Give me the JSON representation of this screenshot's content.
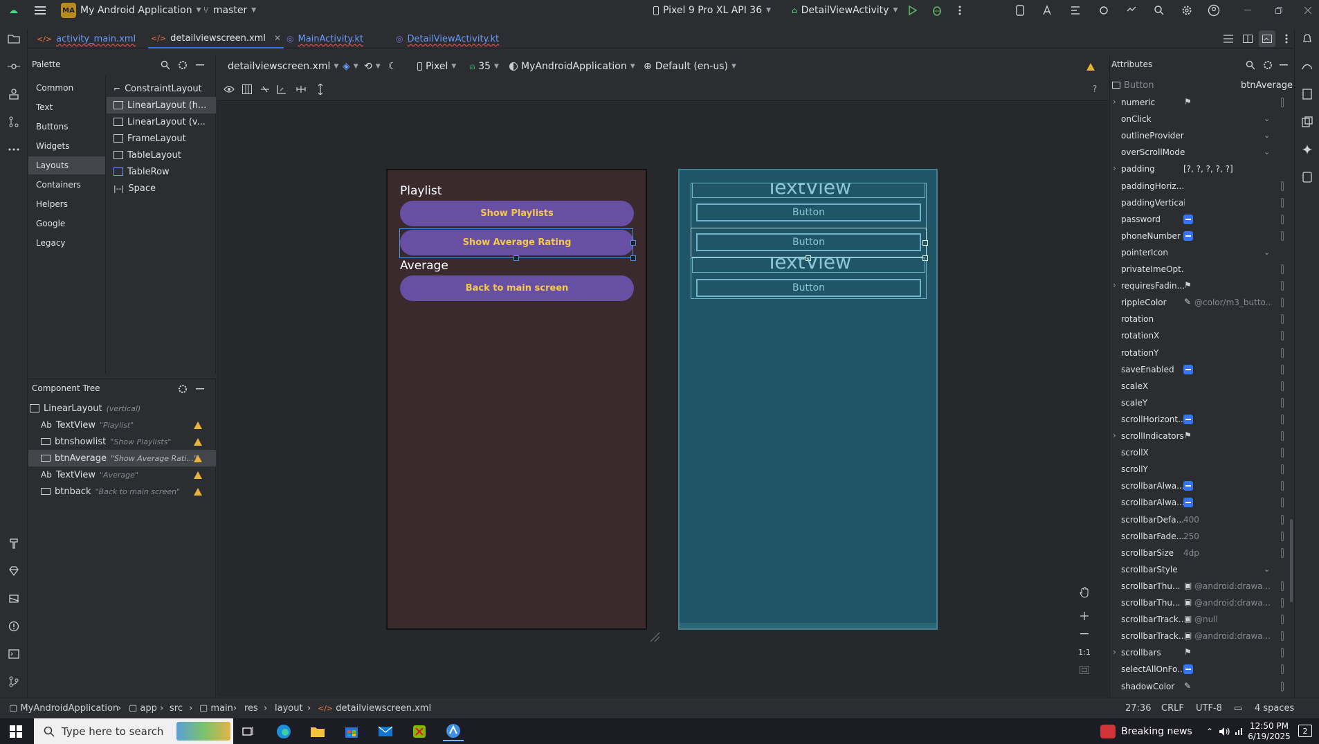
{
  "titlebar": {
    "project_badge": "MA",
    "project_name": "My Android Application",
    "branch": "master",
    "device": "Pixel 9 Pro XL API 36",
    "run_config": "DetailViewActivity"
  },
  "tabs": [
    {
      "label": "activity_main.xml"
    },
    {
      "label": "detailviewscreen.xml"
    },
    {
      "label": "MainActivity.kt"
    },
    {
      "label": "DetailViewActivity.kt"
    }
  ],
  "palette": {
    "title": "Palette",
    "categories": [
      "Common",
      "Text",
      "Buttons",
      "Widgets",
      "Layouts",
      "Containers",
      "Helpers",
      "Google",
      "Legacy"
    ],
    "items": [
      "ConstraintLayout",
      "LinearLayout (h...",
      "LinearLayout (v...",
      "FrameLayout",
      "TableLayout",
      "TableRow",
      "Space"
    ]
  },
  "component_tree": {
    "title": "Component Tree",
    "rows": [
      {
        "name": "LinearLayout",
        "hint": "(vertical)"
      },
      {
        "name": "TextView",
        "hint": "\"Playlist\"",
        "prefix": "Ab"
      },
      {
        "name": "btnshowlist",
        "hint": "\"Show Playlists\""
      },
      {
        "name": "btnAverage",
        "hint": "\"Show Average Rati...\""
      },
      {
        "name": "TextView",
        "hint": "\"Average\"",
        "prefix": "Ab"
      },
      {
        "name": "btnback",
        "hint": "\"Back to main screen\""
      }
    ]
  },
  "design_toolbar": {
    "file": "detailviewscreen.xml",
    "device": "Pixel",
    "api": "35",
    "theme": "MyAndroidApplication",
    "locale": "Default (en-us)"
  },
  "design": {
    "playlist_label": "Playlist",
    "btn_show_playlists": "Show Playlists",
    "btn_show_average": "Show Average Rating",
    "average_label": "Average",
    "btn_back": "Back to main screen",
    "button_text_color": "#f5c84a",
    "button_color": "#6750a4"
  },
  "blueprint": {
    "textview1": "TextView",
    "button1": "Button",
    "button2": "Button",
    "textview2": "TextView",
    "button3": "Button"
  },
  "zoom": {
    "one_to_one": "1:1"
  },
  "attributes": {
    "title": "Attributes",
    "widget_type": "Button",
    "widget_id": "btnAverage",
    "rows": [
      {
        "name": "numeric",
        "value": "",
        "kind": "flag",
        "expandable": true
      },
      {
        "name": "onClick",
        "value": "",
        "kind": "dropdown"
      },
      {
        "name": "outlineProvider",
        "value": "",
        "kind": "dropdown"
      },
      {
        "name": "overScrollMode",
        "value": "",
        "kind": "dropdown"
      },
      {
        "name": "padding",
        "value": "[?, ?, ?, ?, ?]",
        "kind": "text-white",
        "expandable": true
      },
      {
        "name": "paddingHoriz...",
        "value": "",
        "kind": "end"
      },
      {
        "name": "paddingVertical",
        "value": "",
        "kind": "end"
      },
      {
        "name": "password",
        "value": "",
        "kind": "check"
      },
      {
        "name": "phoneNumber",
        "value": "",
        "kind": "check"
      },
      {
        "name": "pointerIcon",
        "value": "",
        "kind": "dropdown"
      },
      {
        "name": "privateImeOpt...",
        "value": "",
        "kind": "end"
      },
      {
        "name": "requiresFadin...",
        "value": "",
        "kind": "flag",
        "expandable": true
      },
      {
        "name": "rippleColor",
        "value": "@color/m3_butto...",
        "kind": "pencil"
      },
      {
        "name": "rotation",
        "value": "",
        "kind": "end"
      },
      {
        "name": "rotationX",
        "value": "",
        "kind": "end"
      },
      {
        "name": "rotationY",
        "value": "",
        "kind": "end"
      },
      {
        "name": "saveEnabled",
        "value": "",
        "kind": "check"
      },
      {
        "name": "scaleX",
        "value": "",
        "kind": "end"
      },
      {
        "name": "scaleY",
        "value": "",
        "kind": "end"
      },
      {
        "name": "scrollHorizont...",
        "value": "",
        "kind": "check"
      },
      {
        "name": "scrollIndicators",
        "value": "",
        "kind": "flag",
        "expandable": true
      },
      {
        "name": "scrollX",
        "value": "",
        "kind": "end"
      },
      {
        "name": "scrollY",
        "value": "",
        "kind": "end"
      },
      {
        "name": "scrollbarAlwa...",
        "value": "",
        "kind": "check"
      },
      {
        "name": "scrollbarAlwa...",
        "value": "",
        "kind": "check"
      },
      {
        "name": "scrollbarDefa...",
        "value": "400",
        "kind": "text"
      },
      {
        "name": "scrollbarFade...",
        "value": "250",
        "kind": "text"
      },
      {
        "name": "scrollbarSize",
        "value": "4dp",
        "kind": "text"
      },
      {
        "name": "scrollbarStyle",
        "value": "",
        "kind": "dropdown"
      },
      {
        "name": "scrollbarThu...",
        "value": "@android:drawa...",
        "kind": "image"
      },
      {
        "name": "scrollbarThu...",
        "value": "@android:drawa...",
        "kind": "image"
      },
      {
        "name": "scrollbarTrack...",
        "value": "@null",
        "kind": "image"
      },
      {
        "name": "scrollbarTrack...",
        "value": "@android:drawa...",
        "kind": "image"
      },
      {
        "name": "scrollbars",
        "value": "",
        "kind": "flag",
        "expandable": true
      },
      {
        "name": "selectAllOnFo...",
        "value": "",
        "kind": "check"
      },
      {
        "name": "shadowColor",
        "value": "",
        "kind": "pencil"
      }
    ]
  },
  "statusbar": {
    "crumbs": [
      "MyAndroidApplication",
      "app",
      "src",
      "main",
      "res",
      "layout",
      "detailviewscreen.xml"
    ],
    "position": "27:36",
    "line_sep": "CRLF",
    "encoding": "UTF-8",
    "indent": "4 spaces"
  },
  "taskbar": {
    "search_placeholder": "Type here to search",
    "news": "Breaking news",
    "time": "12:50 PM",
    "date": "6/19/2025",
    "notif_count": "2"
  }
}
